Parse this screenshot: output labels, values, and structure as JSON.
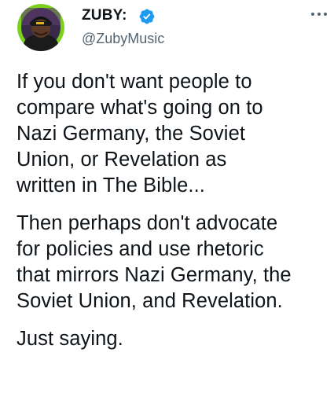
{
  "author": {
    "name": "ZUBY:",
    "handle": "@ZubyMusic",
    "verified": true,
    "avatar_icon": "profile-photo-icon"
  },
  "more_icon": "more-options-icon",
  "colors": {
    "text": "#0f1419",
    "secondary_text": "#536471",
    "verified_blue": "#1d9bf0",
    "avatar_ring": "#7cd11c"
  },
  "tweet": {
    "paragraphs": [
      "If you don't want people to\ncompare what's going on to\nNazi Germany, the Soviet\nUnion, or Revelation as\nwritten in The Bible...",
      "Then perhaps don't advocate\nfor policies and use rhetoric\nthat mirrors Nazi Germany, the\nSoviet Union, and Revelation.",
      "Just saying."
    ]
  }
}
